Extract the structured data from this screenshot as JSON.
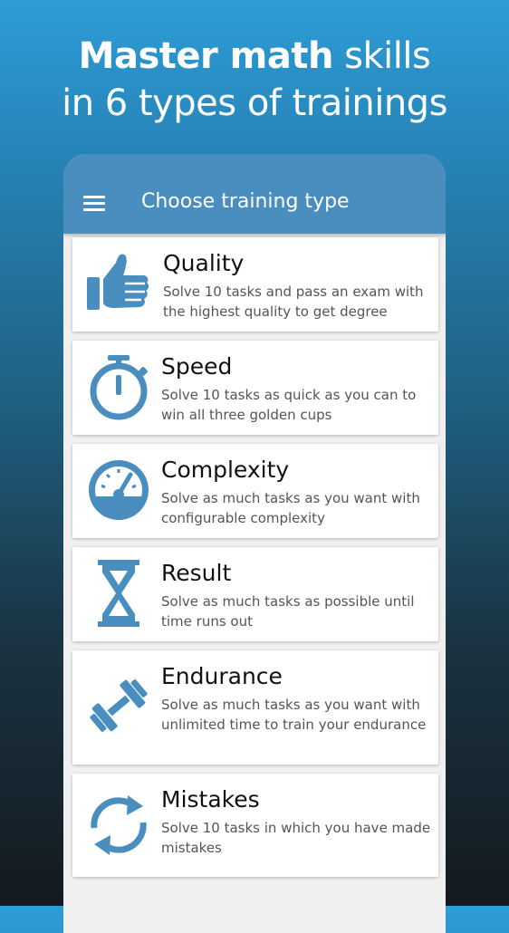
{
  "headline": {
    "bold": "Master math",
    "rest": "skills",
    "line2": "in 6 types of trainings"
  },
  "appbar": {
    "title": "Choose training type"
  },
  "colors": {
    "accent": "#4a8ec0",
    "icon": "#4a8ec0"
  },
  "trainings": [
    {
      "title": "Quality",
      "icon": "thumbs-up-icon",
      "desc": "Solve 10 tasks and pass an exam with the highest quality to get degree"
    },
    {
      "title": "Speed",
      "icon": "stopwatch-icon",
      "desc": "Solve 10 tasks as quick as you can to win all three golden cups"
    },
    {
      "title": "Complexity",
      "icon": "gauge-icon",
      "desc": "Solve as much tasks as you want with configurable complexity"
    },
    {
      "title": "Result",
      "icon": "hourglass-icon",
      "desc": "Solve as much tasks as possible until time runs out"
    },
    {
      "title": "Endurance",
      "icon": "dumbbell-icon",
      "desc": "Solve as much tasks as you want with unlimited time to train your endurance"
    },
    {
      "title": "Mistakes",
      "icon": "refresh-icon",
      "desc": "Solve 10 tasks in which you have made mistakes"
    }
  ]
}
